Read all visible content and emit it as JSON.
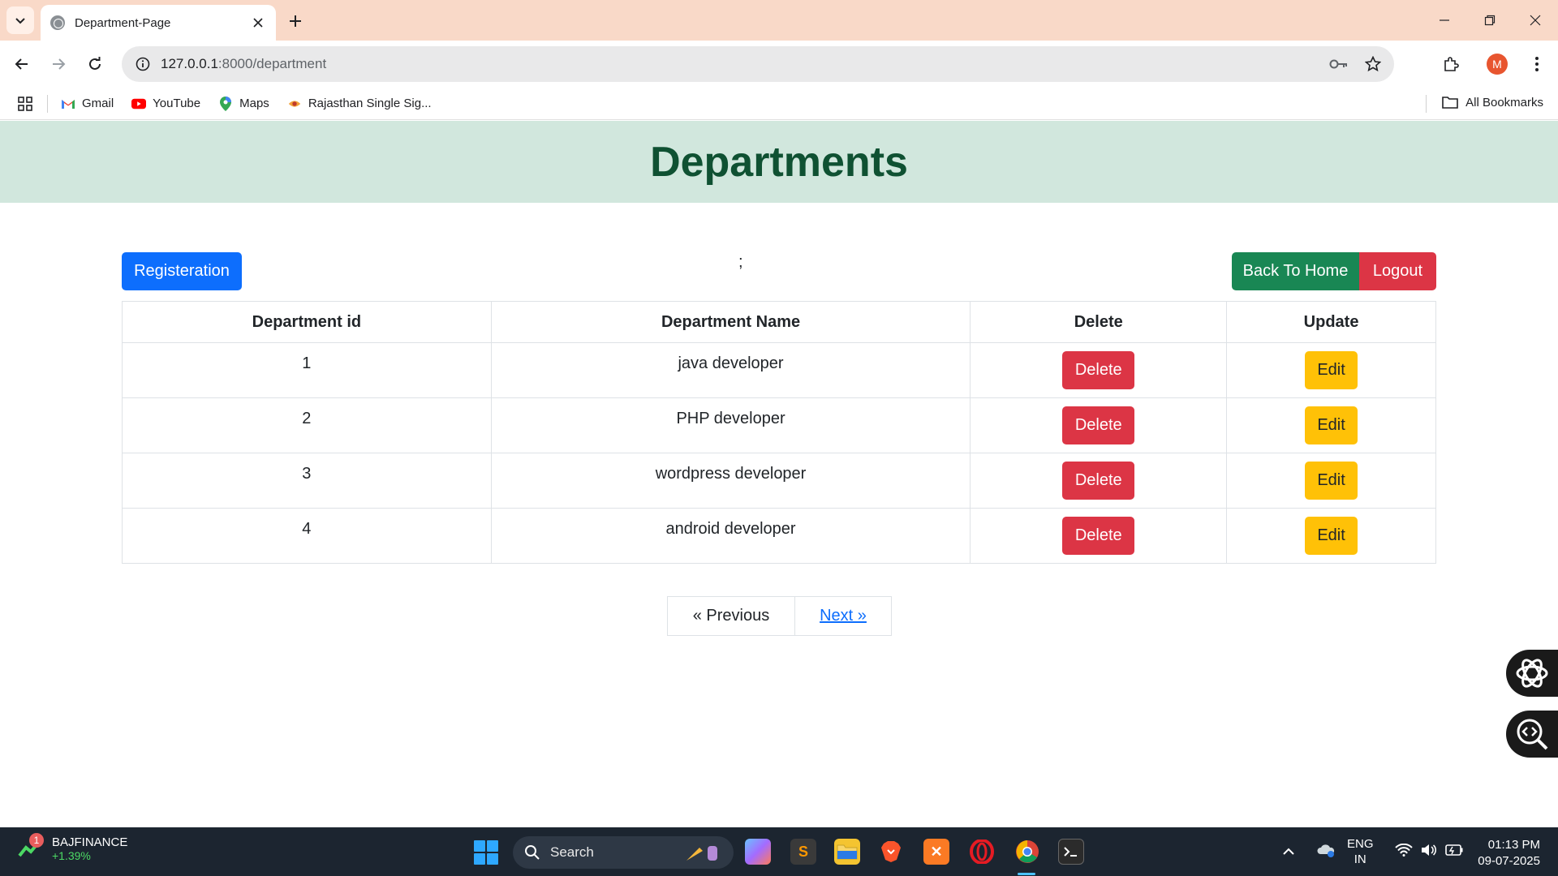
{
  "browser": {
    "tab_title": "Department-Page",
    "url_host": "127.0.0.1",
    "url_path": ":8000/department",
    "profile_initial": "M",
    "bookmarks": [
      {
        "label": "Gmail",
        "icon": "gmail-icon"
      },
      {
        "label": "YouTube",
        "icon": "youtube-icon"
      },
      {
        "label": "Maps",
        "icon": "maps-icon"
      },
      {
        "label": "Rajasthan Single Sig...",
        "icon": "rajasthan-icon"
      }
    ],
    "all_bookmarks": "All Bookmarks"
  },
  "page": {
    "title": "Departments",
    "registration_label": "Registeration",
    "separator_text": ";",
    "back_home_label": "Back To Home",
    "logout_label": "Logout",
    "table": {
      "headers": [
        "Department id",
        "Department Name",
        "Delete",
        "Update"
      ],
      "rows": [
        {
          "id": "1",
          "name": "java developer",
          "delete": "Delete",
          "edit": "Edit"
        },
        {
          "id": "2",
          "name": "PHP developer",
          "delete": "Delete",
          "edit": "Edit"
        },
        {
          "id": "3",
          "name": "wordpress developer",
          "delete": "Delete",
          "edit": "Edit"
        },
        {
          "id": "4",
          "name": "android developer",
          "delete": "Delete",
          "edit": "Edit"
        }
      ]
    },
    "pagination": {
      "previous": "« Previous",
      "next": "Next »"
    }
  },
  "taskbar": {
    "stock_name": "BAJFINANCE",
    "stock_change": "+1.39%",
    "stock_badge": "1",
    "search_label": "Search",
    "lang_top": "ENG",
    "lang_bottom": "IN",
    "time": "01:13 PM",
    "date": "09-07-2025"
  },
  "colors": {
    "header_band": "#d1e7dd",
    "title": "#0f5132",
    "primary": "#0d6efd",
    "success": "#198754",
    "danger": "#dc3545",
    "warning": "#ffc107"
  }
}
